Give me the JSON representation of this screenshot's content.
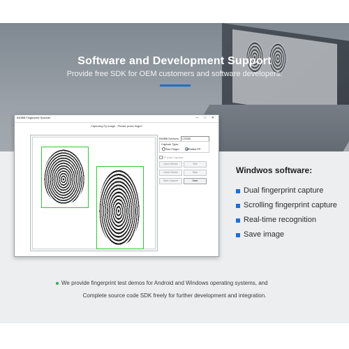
{
  "hero": {
    "title": "Software and Development Support",
    "subtitle": "Provide free SDK for OEM customers and software developers.",
    "accent_color": "#1e6fd0"
  },
  "window": {
    "title": "BIOBB Fingerprint Scanner",
    "controls": "—  □  ✕",
    "status": "Capturing Fp image : Please press finger!",
    "device_label": "BIOBB Devices:",
    "device_value": "CS300",
    "capture_type_label": "Capture Type:",
    "radio_two_finger": "Two Finger",
    "radio_rolled": "Rolled FP",
    "checkbox_label": "FP Auto Capture",
    "buttons": {
      "open": "Open Device",
      "close": "Close Device",
      "start": "Start Capture",
      "stop": "Stop",
      "save": "Save",
      "exit": "Exit"
    },
    "box_color": "#31c63a"
  },
  "features": {
    "title": "Windwos software:",
    "items": [
      "Dual fingerprint capture",
      "Scrolling fingerprint capture",
      "Real-time recognition",
      "Save image"
    ],
    "bullet_color": "#1e6fd0"
  },
  "note": {
    "line1": "We provide fingerprint test demos for Android and Windows operating systems, and",
    "line2": "Complete source code SDK freely for further development and integration.",
    "dot_color": "#22b24c"
  }
}
